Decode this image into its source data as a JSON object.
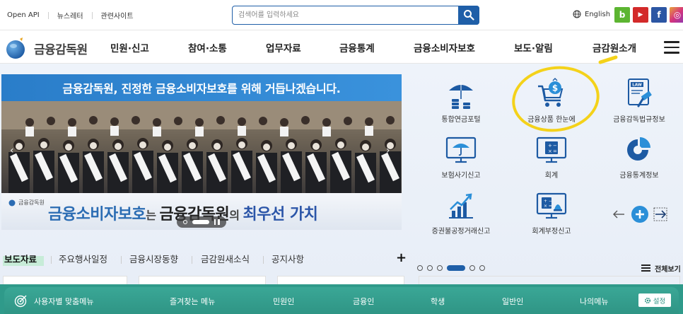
{
  "utility": {
    "links": [
      "Open API",
      "뉴스레터",
      "관련사이트"
    ],
    "language": "English"
  },
  "search": {
    "placeholder": "검색어를 입력하세요"
  },
  "social": {
    "blog": "b",
    "youtube": "▶",
    "facebook": "f",
    "instagram": "◎"
  },
  "logo": {
    "text": "금융감독원"
  },
  "nav": {
    "items": [
      "민원·신고",
      "참여·소통",
      "업무자료",
      "금융통계",
      "금융소비자보호",
      "보도·알림",
      "금감원소개"
    ]
  },
  "banner": {
    "headline": "금융감독원, 진정한 금융소비자보호를 위해 거듭나겠습니다.",
    "footer_logo": "금융감독원",
    "slogan_part1": "금융소비자보호",
    "slogan_part2": "는 ",
    "slogan_part3": "금융감독원",
    "slogan_part4": "의 ",
    "slogan_part5": "최우선 가치"
  },
  "quick_menu": {
    "items": [
      {
        "label": "통합연금포털",
        "icon": "umbrella-coins-icon"
      },
      {
        "label": "금융상품 한눈에",
        "icon": "shopping-cart-dollar-icon"
      },
      {
        "label": "금융감독법규정보",
        "icon": "law-gavel-icon"
      },
      {
        "label": "보험사기신고",
        "icon": "monitor-umbrella-icon"
      },
      {
        "label": "회계",
        "icon": "calculator-monitor-icon"
      },
      {
        "label": "금융통계정보",
        "icon": "pie-chart-icon"
      },
      {
        "label": "증권불공정거래신고",
        "icon": "rising-chart-icon"
      },
      {
        "label": "회계부정신고",
        "icon": "monitor-alert-icon"
      }
    ],
    "view_all": "전체보기"
  },
  "news_tabs": {
    "items": [
      "보도자료",
      "주요행사일정",
      "금융시장동향",
      "금감원새소식",
      "공지사항"
    ],
    "active": "보도자료",
    "plus": "+"
  },
  "bottom_bar": {
    "title": "사용자별 맞춤메뉴",
    "items": [
      "즐겨찾는 메뉴",
      "민원인",
      "금융인",
      "학생",
      "일반인",
      "나의메뉴"
    ],
    "settings": "설정"
  },
  "colors": {
    "primary_blue": "#1f5fa8",
    "bottom_teal": "#2f9a8a",
    "highlight_yellow": "#f4d21a",
    "active_tab_green": "#c7ecd8"
  }
}
